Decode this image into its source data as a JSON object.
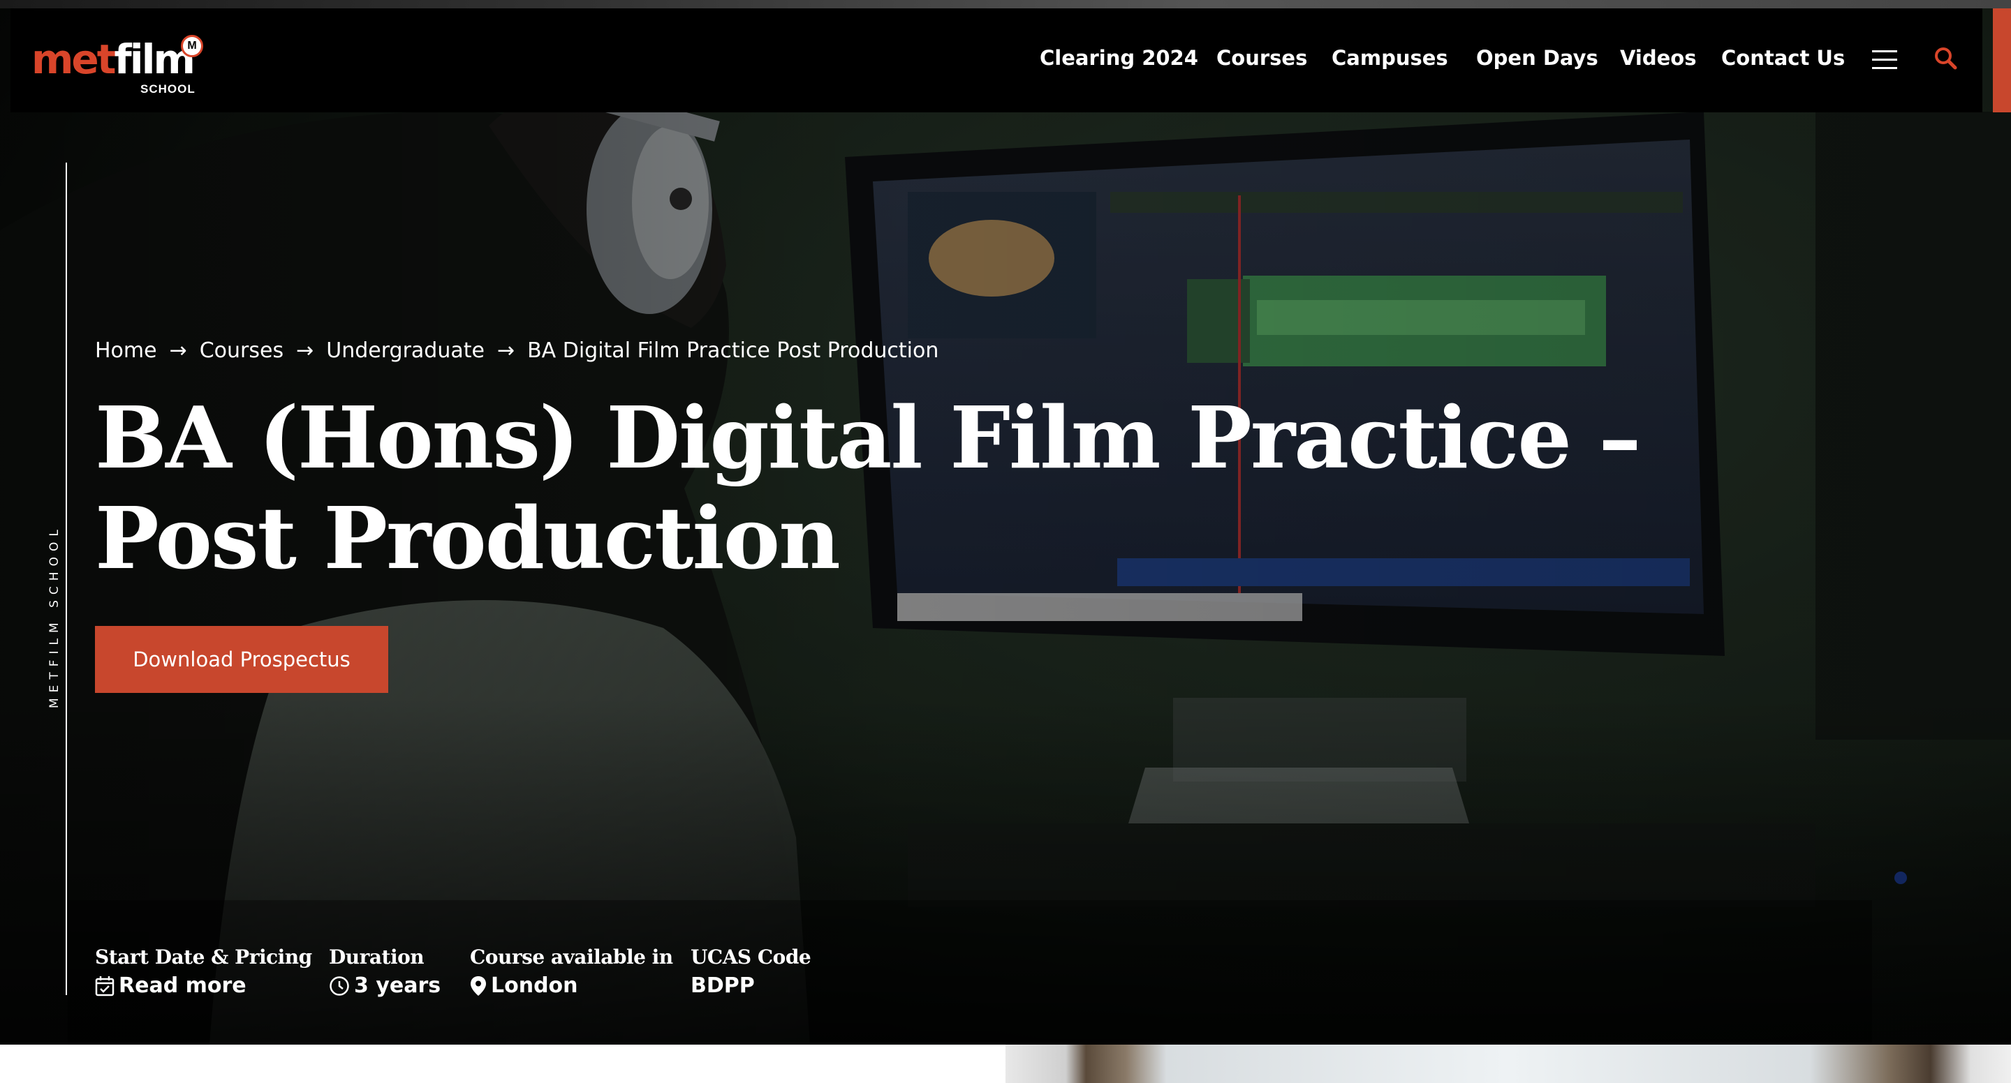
{
  "header": {
    "logo_text_met": "met",
    "logo_text_film": "film",
    "logo_sub": "SCHOOL",
    "logo_badge": "M",
    "nav": [
      {
        "label": "Clearing 2024"
      },
      {
        "label": "Courses"
      },
      {
        "label": "Campuses"
      },
      {
        "label": "Open Days"
      },
      {
        "label": "Videos"
      },
      {
        "label": "Contact Us"
      }
    ],
    "menu_icon": "hamburger-menu-icon",
    "search_icon": "search-icon"
  },
  "side_label": "METFILM SCHOOL",
  "breadcrumb": [
    {
      "label": "Home"
    },
    {
      "label": "Courses"
    },
    {
      "label": "Undergraduate"
    },
    {
      "label": "BA Digital Film Practice Post Production"
    }
  ],
  "hero": {
    "title": "BA (Hons) Digital Film Practice – Post Production",
    "cta_label": "Download Prospectus"
  },
  "info": {
    "start_date": {
      "label": "Start Date & Pricing",
      "value": "Read more",
      "icon": "calendar-check-icon"
    },
    "duration": {
      "label": "Duration",
      "value": "3 years",
      "icon": "clock-icon"
    },
    "location": {
      "label": "Course available in",
      "value": "London",
      "icon": "map-pin-icon"
    },
    "ucas": {
      "label": "UCAS Code",
      "value": "BDPP"
    }
  },
  "colors": {
    "accent": "#c8472d",
    "header_bg": "#000000",
    "text": "#ffffff"
  }
}
